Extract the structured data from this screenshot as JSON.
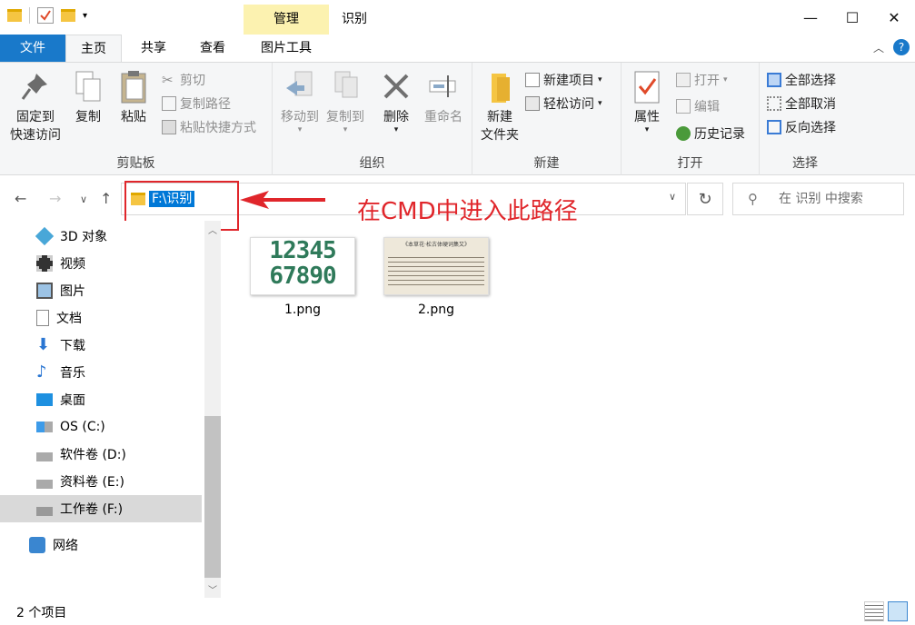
{
  "window": {
    "title": "识别",
    "context_tab": "管理",
    "minimize": "—",
    "maximize": "☐",
    "close": "✕"
  },
  "ribbon_tabs": [
    "文件",
    "主页",
    "共享",
    "查看",
    "图片工具"
  ],
  "ribbon": {
    "clipboard": {
      "label": "剪贴板",
      "pin": "固定到\n快速访问",
      "copy": "复制",
      "paste": "粘贴",
      "cut": "剪切",
      "copy_path": "复制路径",
      "paste_shortcut": "粘贴快捷方式"
    },
    "organize": {
      "label": "组织",
      "move_to": "移动到",
      "copy_to": "复制到",
      "delete": "删除",
      "rename": "重命名"
    },
    "new": {
      "label": "新建",
      "new_folder": "新建\n文件夹",
      "new_item": "新建项目",
      "easy_access": "轻松访问"
    },
    "open": {
      "label": "打开",
      "properties": "属性",
      "open": "打开",
      "edit": "编辑",
      "history": "历史记录"
    },
    "select": {
      "label": "选择",
      "select_all": "全部选择",
      "select_none": "全部取消",
      "invert": "反向选择"
    }
  },
  "address": {
    "path": "F:\\识别",
    "search_placeholder": "在 识别 中搜索"
  },
  "annotation": "在CMD中进入此路径",
  "sidebar": {
    "items": [
      {
        "label": "3D 对象",
        "icon": "3d-objects-icon"
      },
      {
        "label": "视频",
        "icon": "video-icon"
      },
      {
        "label": "图片",
        "icon": "pictures-icon"
      },
      {
        "label": "文档",
        "icon": "documents-icon"
      },
      {
        "label": "下载",
        "icon": "downloads-icon"
      },
      {
        "label": "音乐",
        "icon": "music-icon"
      },
      {
        "label": "桌面",
        "icon": "desktop-icon"
      },
      {
        "label": "OS (C:)",
        "icon": "drive-c-icon"
      },
      {
        "label": "软件卷 (D:)",
        "icon": "drive-icon"
      },
      {
        "label": "资料卷 (E:)",
        "icon": "drive-icon"
      },
      {
        "label": "工作卷 (F:)",
        "icon": "drive-icon"
      },
      {
        "label": "网络",
        "icon": "network-icon"
      }
    ]
  },
  "files": [
    {
      "name": "1.png",
      "thumb_text": "12345\n67890"
    },
    {
      "name": "2.png",
      "thumb_text": "《本草花·松古体硬词集又》"
    }
  ],
  "status": {
    "count": "2 个项目"
  },
  "colors": {
    "accent": "#1979ca",
    "annotation": "#e0262b",
    "selection": "#0078d7",
    "manage_tab": "#fcf2b0"
  }
}
